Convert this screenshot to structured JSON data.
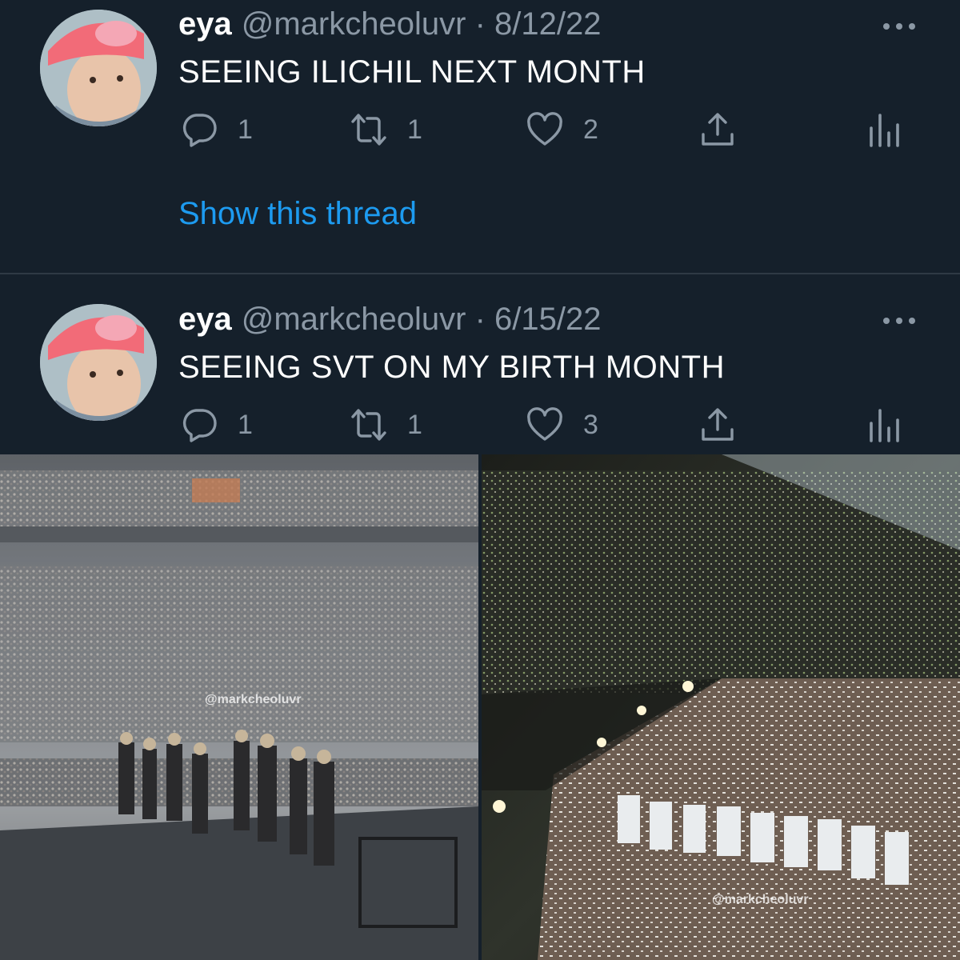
{
  "tweets": [
    {
      "name": "eya",
      "handle": "@markcheoluvr",
      "separator": "·",
      "date": "8/12/22",
      "text": "SEEING ILICHIL NEXT MONTH",
      "replies": "1",
      "retweets": "1",
      "likes": "2",
      "show_thread": "Show this thread"
    },
    {
      "name": "eya",
      "handle": "@markcheoluvr",
      "separator": "·",
      "date": "6/15/22",
      "text": "SEEING SVT ON MY BIRTH MONTH",
      "replies": "1",
      "retweets": "1",
      "likes": "3"
    }
  ],
  "photos": {
    "left_watermark": "@markcheoluvr",
    "right_watermark": "@markcheoluvr"
  },
  "icons": {
    "reply": "reply-icon",
    "retweet": "retweet-icon",
    "like": "heart-icon",
    "share": "share-icon",
    "stats": "stats-icon",
    "more": "more-icon"
  },
  "colors": {
    "background": "#15202b",
    "accent": "#1d9bf0",
    "secondary_text": "#8b98a5"
  }
}
